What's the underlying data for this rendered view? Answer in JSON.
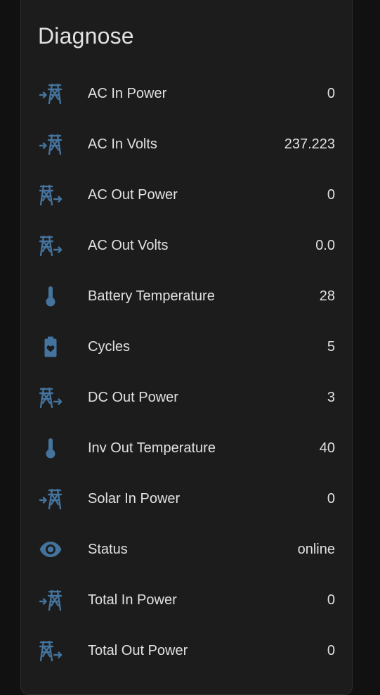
{
  "card": {
    "title": "Diagnose"
  },
  "rows": [
    {
      "icon": "transmission-tower-import-icon",
      "label": "AC In Power",
      "value": "0"
    },
    {
      "icon": "transmission-tower-import-icon",
      "label": "AC In Volts",
      "value": "237.223"
    },
    {
      "icon": "transmission-tower-export-icon",
      "label": "AC Out Power",
      "value": "0"
    },
    {
      "icon": "transmission-tower-export-icon",
      "label": "AC Out Volts",
      "value": "0.0"
    },
    {
      "icon": "thermometer-icon",
      "label": "Battery Temperature",
      "value": "28"
    },
    {
      "icon": "battery-heart-icon",
      "label": "Cycles",
      "value": "5"
    },
    {
      "icon": "transmission-tower-export-icon",
      "label": "DC Out Power",
      "value": "3"
    },
    {
      "icon": "thermometer-icon",
      "label": "Inv Out Temperature",
      "value": "40"
    },
    {
      "icon": "transmission-tower-import-icon",
      "label": "Solar In Power",
      "value": "0"
    },
    {
      "icon": "eye-icon",
      "label": "Status",
      "value": "online"
    },
    {
      "icon": "transmission-tower-import-icon",
      "label": "Total In Power",
      "value": "0"
    },
    {
      "icon": "transmission-tower-export-icon",
      "label": "Total Out Power",
      "value": "0"
    }
  ],
  "colors": {
    "background": "#111111",
    "card": "#1c1c1c",
    "icon": "#44739e",
    "text": "#e1e1e1"
  }
}
